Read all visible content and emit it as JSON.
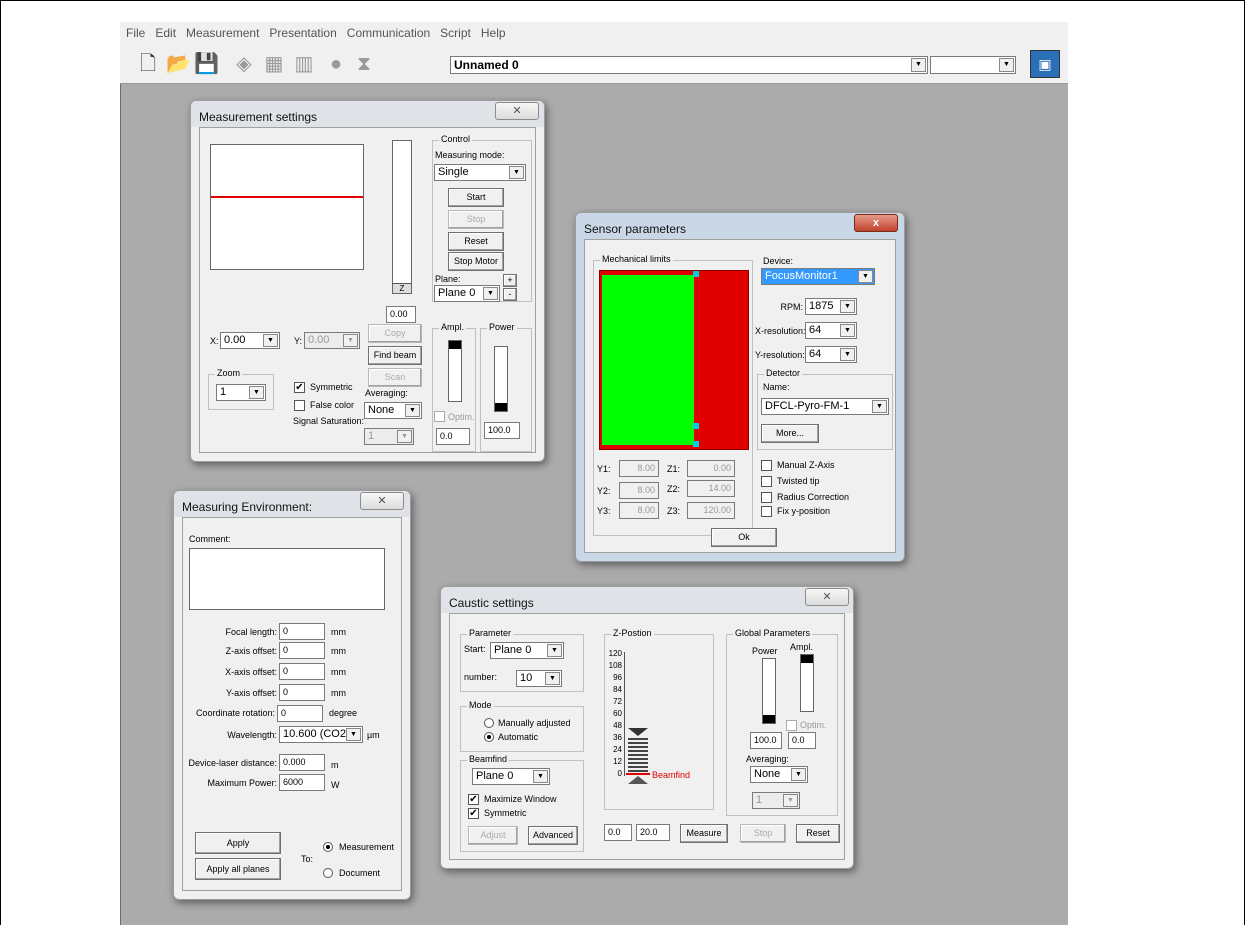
{
  "menu": [
    "File",
    "Edit",
    "Measurement",
    "Presentation",
    "Communication",
    "Script",
    "Help"
  ],
  "toolbar": {
    "document": "Unnamed 0",
    "second_combo": ""
  },
  "ms": {
    "title": "Measurement settings",
    "control": "Control",
    "measuring_mode": "Measuring mode:",
    "mode_value": "Single",
    "start": "Start",
    "stop": "Stop",
    "reset": "Reset",
    "stop_motor": "Stop Motor",
    "plane": "Plane:",
    "plane_value": "Plane 0",
    "plus": "+",
    "minus": "-",
    "z": "Z",
    "z_value": "0.00",
    "x_label": "X:",
    "x_value": "0.00",
    "y_label": "Y:",
    "y_value": "0.00",
    "copy": "Copy",
    "find_beam": "Find beam",
    "scan": "Scan",
    "zoom": "Zoom",
    "zoom_value": "1",
    "symmetric": "Symmetric",
    "false_color": "False color",
    "averaging": "Averaging:",
    "averaging_value": "None",
    "signal_saturation": "Signal Saturation:",
    "saturation_value": "1",
    "ampl": "Ampl.",
    "power": "Power",
    "optim": "Optim.",
    "ampl_value": "0.0",
    "power_value": "100.0"
  },
  "sp": {
    "title": "Sensor parameters",
    "close": "x",
    "mechanical_limits": "Mechanical limits",
    "device": "Device:",
    "device_value": "FocusMonitor1",
    "rpm": "RPM:",
    "rpm_value": "1875",
    "xres": "X-resolution:",
    "xres_value": "64",
    "yres": "Y-resolution:",
    "yres_value": "64",
    "detector": "Detector",
    "name": "Name:",
    "name_value": "DFCL-Pyro-FM-1",
    "more": "More...",
    "manual_z": "Manual Z-Axis",
    "twisted_tip": "Twisted tip",
    "radius_correction": "Radius Correction",
    "fix_y": "Fix y-position",
    "y1": "Y1:",
    "y1v": "8.00",
    "y2": "Y2:",
    "y2v": "8.00",
    "y3": "Y3:",
    "y3v": "8.00",
    "z1": "Z1:",
    "z1v": "0.00",
    "z2": "Z2:",
    "z2v": "14.00",
    "z3": "Z3:",
    "z3v": "120.00",
    "ok": "Ok"
  },
  "me": {
    "title": "Measuring Environment:",
    "comment": "Comment:",
    "focal_length": "Focal length:",
    "focal_value": "0",
    "z_offset": "Z-axis offset:",
    "z_offset_value": "0",
    "x_offset": "X-axis offset:",
    "x_offset_value": "0",
    "y_offset": "Y-axis offset:",
    "y_offset_value": "0",
    "coord_rot": "Coordinate rotation:",
    "coord_rot_value": "0",
    "wavelength": "Wavelength:",
    "wavelength_value": "10.600 (CO2)",
    "distance": "Device-laser distance:",
    "distance_value": "0.000",
    "max_power": "Maximum Power:",
    "max_power_value": "6000",
    "mm": "mm",
    "degree": "degree",
    "um": "µm",
    "m": "m",
    "w": "W",
    "apply": "Apply",
    "apply_all": "Apply all planes",
    "to": "To:",
    "measurement": "Measurement",
    "document": "Document"
  },
  "cs": {
    "title": "Caustic settings",
    "parameter": "Parameter",
    "start": "Start:",
    "start_value": "Plane 0",
    "number": "number:",
    "number_value": "10",
    "mode": "Mode",
    "manually": "Manually adjusted",
    "automatic": "Automatic",
    "beamfind": "Beamfind",
    "beamfind_value": "Plane 0",
    "maximize": "Maximize Window",
    "symmetric": "Symmetric",
    "adjust": "Adjust",
    "advanced": "Advanced",
    "zpos": "Z-Postion",
    "ticks": [
      "120",
      "108",
      "96",
      "84",
      "72",
      "60",
      "48",
      "36",
      "24",
      "12",
      "0"
    ],
    "beamfind_marker": "Beamfind",
    "from_value": "0.0",
    "to_value": "20.0",
    "measure": "Measure",
    "stop": "Stop",
    "reset": "Reset",
    "global": "Global Parameters",
    "power": "Power",
    "ampl": "Ampl.",
    "optim": "Optim.",
    "power_value": "100.0",
    "ampl_value": "0.0",
    "averaging": "Averaging:",
    "averaging_value": "None",
    "sat_value": "1"
  }
}
